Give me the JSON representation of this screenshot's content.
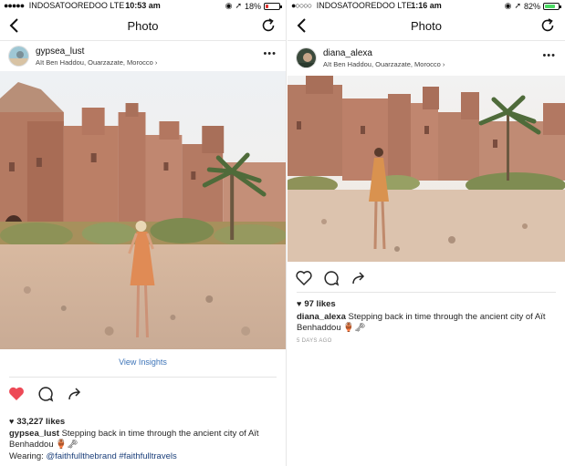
{
  "left": {
    "status": {
      "signal_dots": "●●●●●",
      "carrier": "INDOSATOOREDOO",
      "network": "LTE",
      "time": "10:53 am",
      "battery_text": "18%",
      "battery_level": 0.18,
      "battery_color": "#e0302e"
    },
    "nav": {
      "title": "Photo"
    },
    "post": {
      "username": "gypsea_lust",
      "location": "Aït Ben Haddou, Ouarzazate, Morocco",
      "view_insights": "View Insights",
      "liked": true,
      "likes": "33,227 likes",
      "caption_user": "gypsea_lust",
      "caption_text": "Stepping back in time through the ancient city of Aït Benhaddou 🏺🗝",
      "extra_prefix": "Wearing:",
      "extra_tag1": "@faithfullthebrand",
      "extra_tag2": "#faithfulltravels"
    }
  },
  "right": {
    "status": {
      "signal_dots": "●○○○○",
      "carrier": "INDOSATOOREDOO",
      "network": "LTE",
      "time": "1:16 am",
      "battery_text": "82%",
      "battery_level": 0.82,
      "battery_color": "#4cd964"
    },
    "nav": {
      "title": "Photo"
    },
    "post": {
      "username": "diana_alexa",
      "location": "Aït Ben Haddou, Ouarzazate, Morocco",
      "liked": false,
      "likes": "97 likes",
      "caption_user": "diana_alexa",
      "caption_text": "Stepping back in time through the ancient city of Aït Benhaddou 🏺🗝",
      "time_ago": "5 DAYS AGO"
    }
  },
  "colors": {
    "link_blue": "#3d74b8",
    "heart_red": "#ed4956",
    "sand": "#c89a7a"
  },
  "icons": {
    "back": "chevron-left-icon",
    "refresh": "refresh-icon",
    "more": "more-dots-icon",
    "like": "heart-icon",
    "comment": "comment-icon",
    "share": "share-icon",
    "location_chevron": "chevron-right-icon",
    "alarm": "alarm-icon",
    "gps": "location-arrow-icon"
  }
}
